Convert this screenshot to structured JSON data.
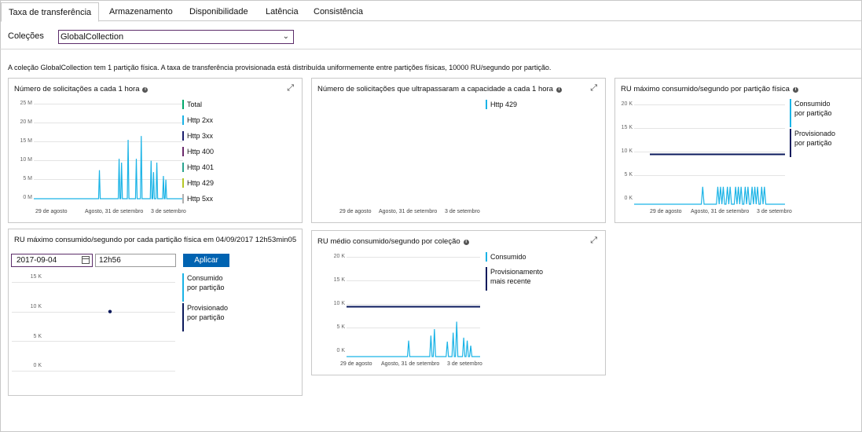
{
  "tabs": [
    {
      "label": "Taxa de transferência",
      "active": true
    },
    {
      "label": "Armazenamento",
      "active": false
    },
    {
      "label": "Disponibilidade",
      "active": false
    },
    {
      "label": "Latência",
      "active": false
    },
    {
      "label": "Consistência",
      "active": false
    }
  ],
  "collections": {
    "label": "Coleções",
    "selected": "GlobalCollection"
  },
  "info_text": "A coleção GlobalCollection tem 1 partição física. A taxa de transferência provisionada está distribuída uniformemente entre partições físicas, 10000 RU/segundo por partição.",
  "colors": {
    "total": "#00a86b",
    "http2xx": "#1ab3e6",
    "http3xx": "#1b1f6e",
    "http400": "#6b2a6b",
    "http401": "#2aa38f",
    "http429": "#b5c726",
    "http5xx": "#b0b0b0",
    "consumed": "#1ab3e6",
    "provisioned": "#0b1a5c",
    "accent_button": "#0063b1"
  },
  "icons": {
    "info": "info-icon",
    "expand": "expand-icon",
    "dropdown": "chevron-down-icon",
    "calendar": "calendar-icon"
  },
  "cards": {
    "requests": {
      "title": "Número de solicitações a cada 1 hora",
      "y_ticks": [
        "25 M",
        "20 M",
        "15 M",
        "10 M",
        "5 M",
        "0 M"
      ],
      "x_ticks": [
        "29 de agosto",
        "Agosto, 31 de setembro",
        "3 de setembro"
      ],
      "legend": [
        "Total",
        "Http 2xx",
        "Http 3xx",
        "Http 400",
        "Http 401",
        "Http 429",
        "Http 5xx"
      ]
    },
    "throttled": {
      "title": "Número de solicitações que ultrapassaram a capacidade a cada 1 hora",
      "x_ticks": [
        "29 de agosto",
        "Agosto, 31 de setembro",
        "3 de setembro"
      ],
      "legend": [
        "Http 429"
      ]
    },
    "max_ru_partition": {
      "title": "RU máximo consumido/segundo por partição física",
      "y_ticks": [
        "20 K",
        "15 K",
        "10 K",
        "5 K",
        "0 K"
      ],
      "x_ticks": [
        "29 de agosto",
        "Agosto, 31 de setembro",
        "3 de setembro"
      ],
      "legend": [
        {
          "line1": "Consumido",
          "line2": "por partição"
        },
        {
          "line1": "Provisionado",
          "line2": "por partição"
        }
      ]
    },
    "max_ru_snapshot": {
      "title": "RU máximo consumido/segundo por cada partição física em 04/09/2017 12h53min05",
      "date_value": "2017-09-04",
      "time_value": "12h56",
      "apply_label": "Aplicar",
      "y_ticks": [
        "15 K",
        "10 K",
        "5 K",
        "0 K"
      ],
      "legend": [
        {
          "line1": "Consumido",
          "line2": "por partição"
        },
        {
          "line1": "Provisionado",
          "line2": "por partição"
        }
      ]
    },
    "avg_ru_collection": {
      "title": "RU médio consumido/segundo por coleção",
      "y_ticks": [
        "20 K",
        "15 K",
        "10 K",
        "5 K",
        "0 K"
      ],
      "x_ticks": [
        "29 de agosto",
        "Agosto, 31 de setembro",
        "3 de setembro"
      ],
      "legend": [
        {
          "line1": "Consumido",
          "line2": ""
        },
        {
          "line1": "Provisionamento",
          "line2": "mais recente"
        }
      ]
    }
  },
  "chart_data": [
    {
      "type": "line",
      "title": "Número de solicitações a cada 1 hora",
      "ylim": [
        0,
        25
      ],
      "yunit": "M",
      "x_ticks": [
        "29 de agosto",
        "Agosto, 31 de setembro",
        "3 de setembro"
      ],
      "series": [
        {
          "name": "Http 2xx",
          "values": [
            0,
            0,
            0,
            0,
            0,
            0,
            0,
            0,
            0,
            0,
            0,
            0,
            0,
            0,
            0,
            0,
            0,
            0,
            0,
            0,
            0,
            0,
            0,
            0,
            0,
            0,
            0,
            0,
            0,
            0,
            0,
            0,
            0,
            0,
            0,
            0,
            0,
            0,
            0,
            0,
            0,
            0,
            0,
            0,
            0,
            0,
            0,
            0,
            0,
            0,
            0,
            0,
            0,
            0,
            0,
            0,
            0,
            0,
            0,
            0,
            0,
            0,
            0,
            0,
            0,
            0,
            0,
            0,
            0,
            0,
            0,
            0,
            0,
            0,
            0,
            0,
            0,
            0,
            0,
            0,
            7.5,
            0,
            0,
            0,
            0,
            0,
            0,
            0,
            0,
            0,
            0,
            0,
            0,
            0,
            0,
            0,
            0,
            0,
            0,
            0,
            0,
            0,
            0,
            0,
            10.5,
            0,
            0,
            9.5,
            0,
            0,
            0,
            0,
            0,
            0,
            0,
            15.5,
            0,
            0,
            0,
            0,
            0,
            0,
            0,
            0,
            0,
            10.5,
            0,
            0,
            0,
            0,
            0,
            16.5,
            0,
            0,
            0,
            0,
            0,
            0,
            0,
            0,
            0,
            0,
            0,
            10,
            0,
            0,
            7,
            0,
            0,
            0,
            9.5,
            0,
            0,
            0,
            0,
            0,
            0,
            0,
            6,
            0,
            0,
            5,
            0,
            0,
            0,
            0,
            0,
            0,
            0,
            0,
            0,
            0,
            0,
            0,
            0,
            0,
            0,
            0,
            0,
            0,
            0,
            0,
            0
          ]
        }
      ]
    },
    {
      "type": "line",
      "title": "Número de solicitações que ultrapassaram a capacidade a cada 1 hora",
      "x_ticks": [
        "29 de agosto",
        "Agosto, 31 de setembro",
        "3 de setembro"
      ],
      "series": [
        {
          "name": "Http 429",
          "values": []
        }
      ]
    },
    {
      "type": "line",
      "title": "RU máximo consumido/segundo por partição física",
      "ylim": [
        0,
        20000
      ],
      "x_ticks": [
        "29 de agosto",
        "Agosto, 31 de setembro",
        "3 de setembro"
      ],
      "series": [
        {
          "name": "Consumido por partição",
          "values": [
            0,
            0,
            0,
            0,
            0,
            0,
            0,
            0,
            0,
            0,
            0,
            0,
            0,
            0,
            0,
            0,
            0,
            0,
            0,
            0,
            0,
            0,
            0,
            0,
            0,
            0,
            0,
            0,
            0,
            0,
            0,
            0,
            0,
            0,
            0,
            0,
            0,
            0,
            0,
            0,
            0,
            0,
            0,
            0,
            0,
            0,
            0,
            0,
            0,
            0,
            3500,
            0,
            0,
            0,
            0,
            0,
            0,
            0,
            0,
            0,
            0,
            3500,
            0,
            3500,
            0,
            3500,
            0,
            0,
            3500,
            0,
            3500,
            0,
            0,
            0,
            3500,
            0,
            3500,
            0,
            3500,
            0,
            0,
            3500,
            0,
            3500,
            0,
            0,
            3500,
            0,
            3500,
            0,
            3500,
            0,
            0,
            3500,
            0,
            3500,
            0,
            0,
            0,
            0,
            0,
            0,
            0,
            0,
            0,
            0,
            0,
            0,
            0,
            0,
            0
          ]
        },
        {
          "name": "Provisionado por partição",
          "values": [
            10000,
            10000
          ]
        }
      ]
    },
    {
      "type": "scatter",
      "title": "RU máximo consumido/segundo por cada partição física em 04/09/2017 12h53min05",
      "ylim": [
        0,
        15000
      ],
      "series": [
        {
          "name": "Provisionado por partição",
          "values": [
            10000
          ]
        }
      ]
    },
    {
      "type": "line",
      "title": "RU médio consumido/segundo por coleção",
      "ylim": [
        0,
        20000
      ],
      "x_ticks": [
        "29 de agosto",
        "Agosto, 31 de setembro",
        "3 de setembro"
      ],
      "series": [
        {
          "name": "Consumido",
          "values": [
            0,
            0,
            0,
            0,
            0,
            0,
            0,
            0,
            0,
            0,
            0,
            0,
            0,
            0,
            0,
            0,
            0,
            0,
            0,
            0,
            0,
            0,
            0,
            0,
            0,
            0,
            0,
            0,
            0,
            0,
            0,
            0,
            0,
            0,
            0,
            0,
            0,
            0,
            0,
            0,
            0,
            0,
            0,
            0,
            0,
            0,
            0,
            0,
            0,
            0,
            0,
            0,
            0,
            3200,
            0,
            0,
            0,
            0,
            0,
            0,
            0,
            0,
            0,
            0,
            0,
            0,
            0,
            0,
            0,
            0,
            0,
            0,
            4200,
            0,
            0,
            5500,
            0,
            0,
            0,
            0,
            0,
            0,
            0,
            0,
            0,
            0,
            3000,
            0,
            0,
            0,
            0,
            4800,
            0,
            0,
            7000,
            0,
            0,
            0,
            0,
            0,
            3800,
            0,
            0,
            3200,
            0,
            0,
            2200,
            0,
            0,
            0,
            0,
            0,
            0,
            0,
            0
          ]
        },
        {
          "name": "Provisionamento mais recente",
          "values": [
            10000,
            10000
          ]
        }
      ]
    }
  ]
}
